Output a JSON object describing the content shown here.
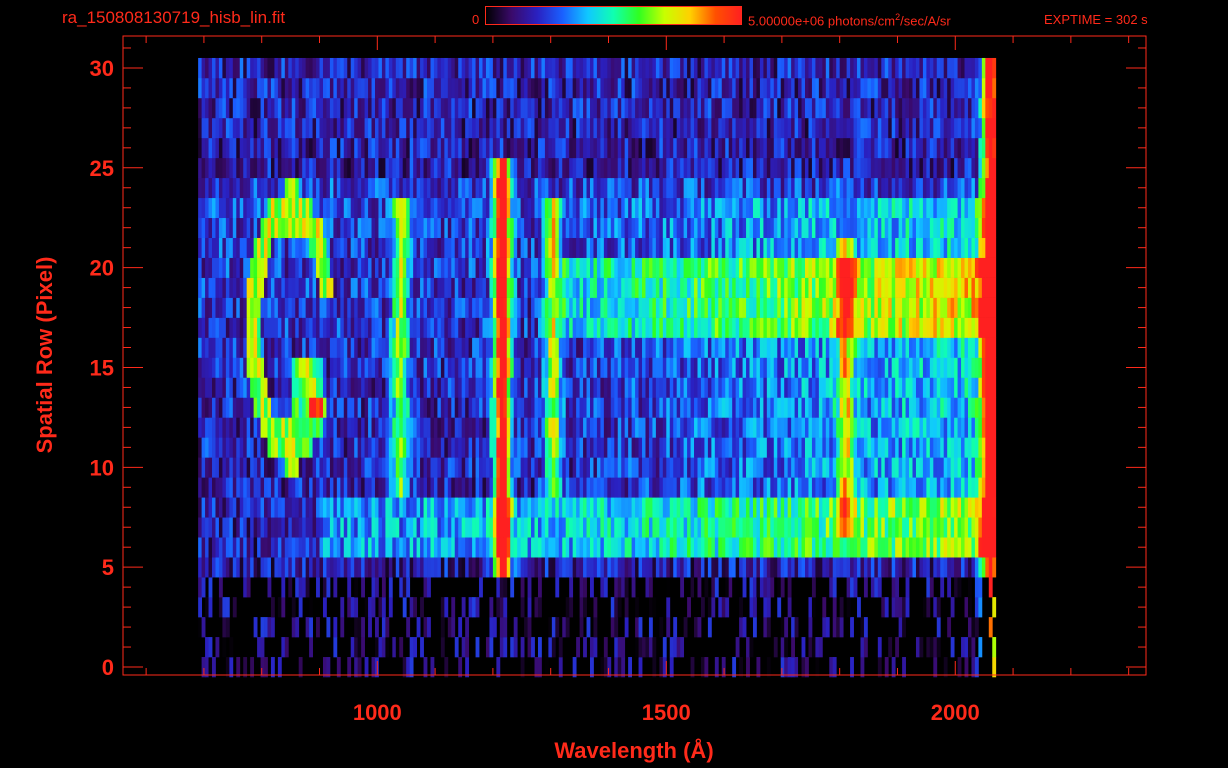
{
  "header": {
    "filename": "ra_150808130719_hisb_lin.fit",
    "colorbar_min_label": "0",
    "colorbar_max_value": "5.00000e+06 photons/cm",
    "colorbar_max_unit_exp": "2",
    "colorbar_max_unit_rest": "/sec/A/sr",
    "exptime_label": "EXPTIME = 302 s"
  },
  "colors": {
    "axis": "#ff2a1a",
    "background": "#000000",
    "colormap": [
      "#000000",
      "#3a0a6a",
      "#2a20c0",
      "#1a60ff",
      "#10c8ff",
      "#10ffb0",
      "#30ff20",
      "#c8ff00",
      "#ffd000",
      "#ff5000",
      "#ff2020"
    ]
  },
  "chart_data": {
    "type": "heatmap",
    "title": "ra_150808130719_hisb_lin.fit",
    "xlabel": "Wavelength (Å)",
    "ylabel": "Spatial Row (Pixel)",
    "xlim": [
      560,
      2330
    ],
    "ylim": [
      -0.4,
      31.6
    ],
    "x_ticks": [
      1000,
      1500,
      2000
    ],
    "x_tick_labels": [
      "1000",
      "1500",
      "2000"
    ],
    "y_ticks": [
      0,
      5,
      10,
      15,
      20,
      25,
      30
    ],
    "y_tick_labels": [
      "0",
      "5",
      "10",
      "15",
      "20",
      "25",
      "30"
    ],
    "colorbar": {
      "min": 0,
      "max": 5000000,
      "unit": "photons/cm^2/sec/A/sr",
      "scale": "linear"
    },
    "grid": false,
    "detector_extent": {
      "x": [
        690,
        2070
      ],
      "rows": [
        0,
        30
      ]
    },
    "features": [
      {
        "name": "Lyman-alpha emission line",
        "wavelength": 1216,
        "rows": [
          5,
          25
        ],
        "peak_intensity": 0.95
      },
      {
        "name": "emission line",
        "wavelength": 1304,
        "rows": [
          9,
          23
        ],
        "peak_intensity": 0.5
      },
      {
        "name": "emission line",
        "wavelength": 1040,
        "rows": [
          9,
          23
        ],
        "peak_intensity": 0.45
      },
      {
        "name": "emission line",
        "wavelength": 1810,
        "rows": [
          7,
          21
        ],
        "peak_intensity": 0.45
      },
      {
        "name": "bright spatial band",
        "rows": [
          6,
          8
        ],
        "wavelength_range": [
          900,
          2060
        ],
        "peak_intensity": 0.5
      },
      {
        "name": "bright spatial band",
        "rows": [
          17,
          20
        ],
        "wavelength_range": [
          1320,
          2060
        ],
        "peak_intensity": 0.6
      },
      {
        "name": "long-wavelength edge",
        "wavelength": 2060,
        "rows": [
          0,
          30
        ],
        "peak_intensity": 0.9
      }
    ]
  }
}
